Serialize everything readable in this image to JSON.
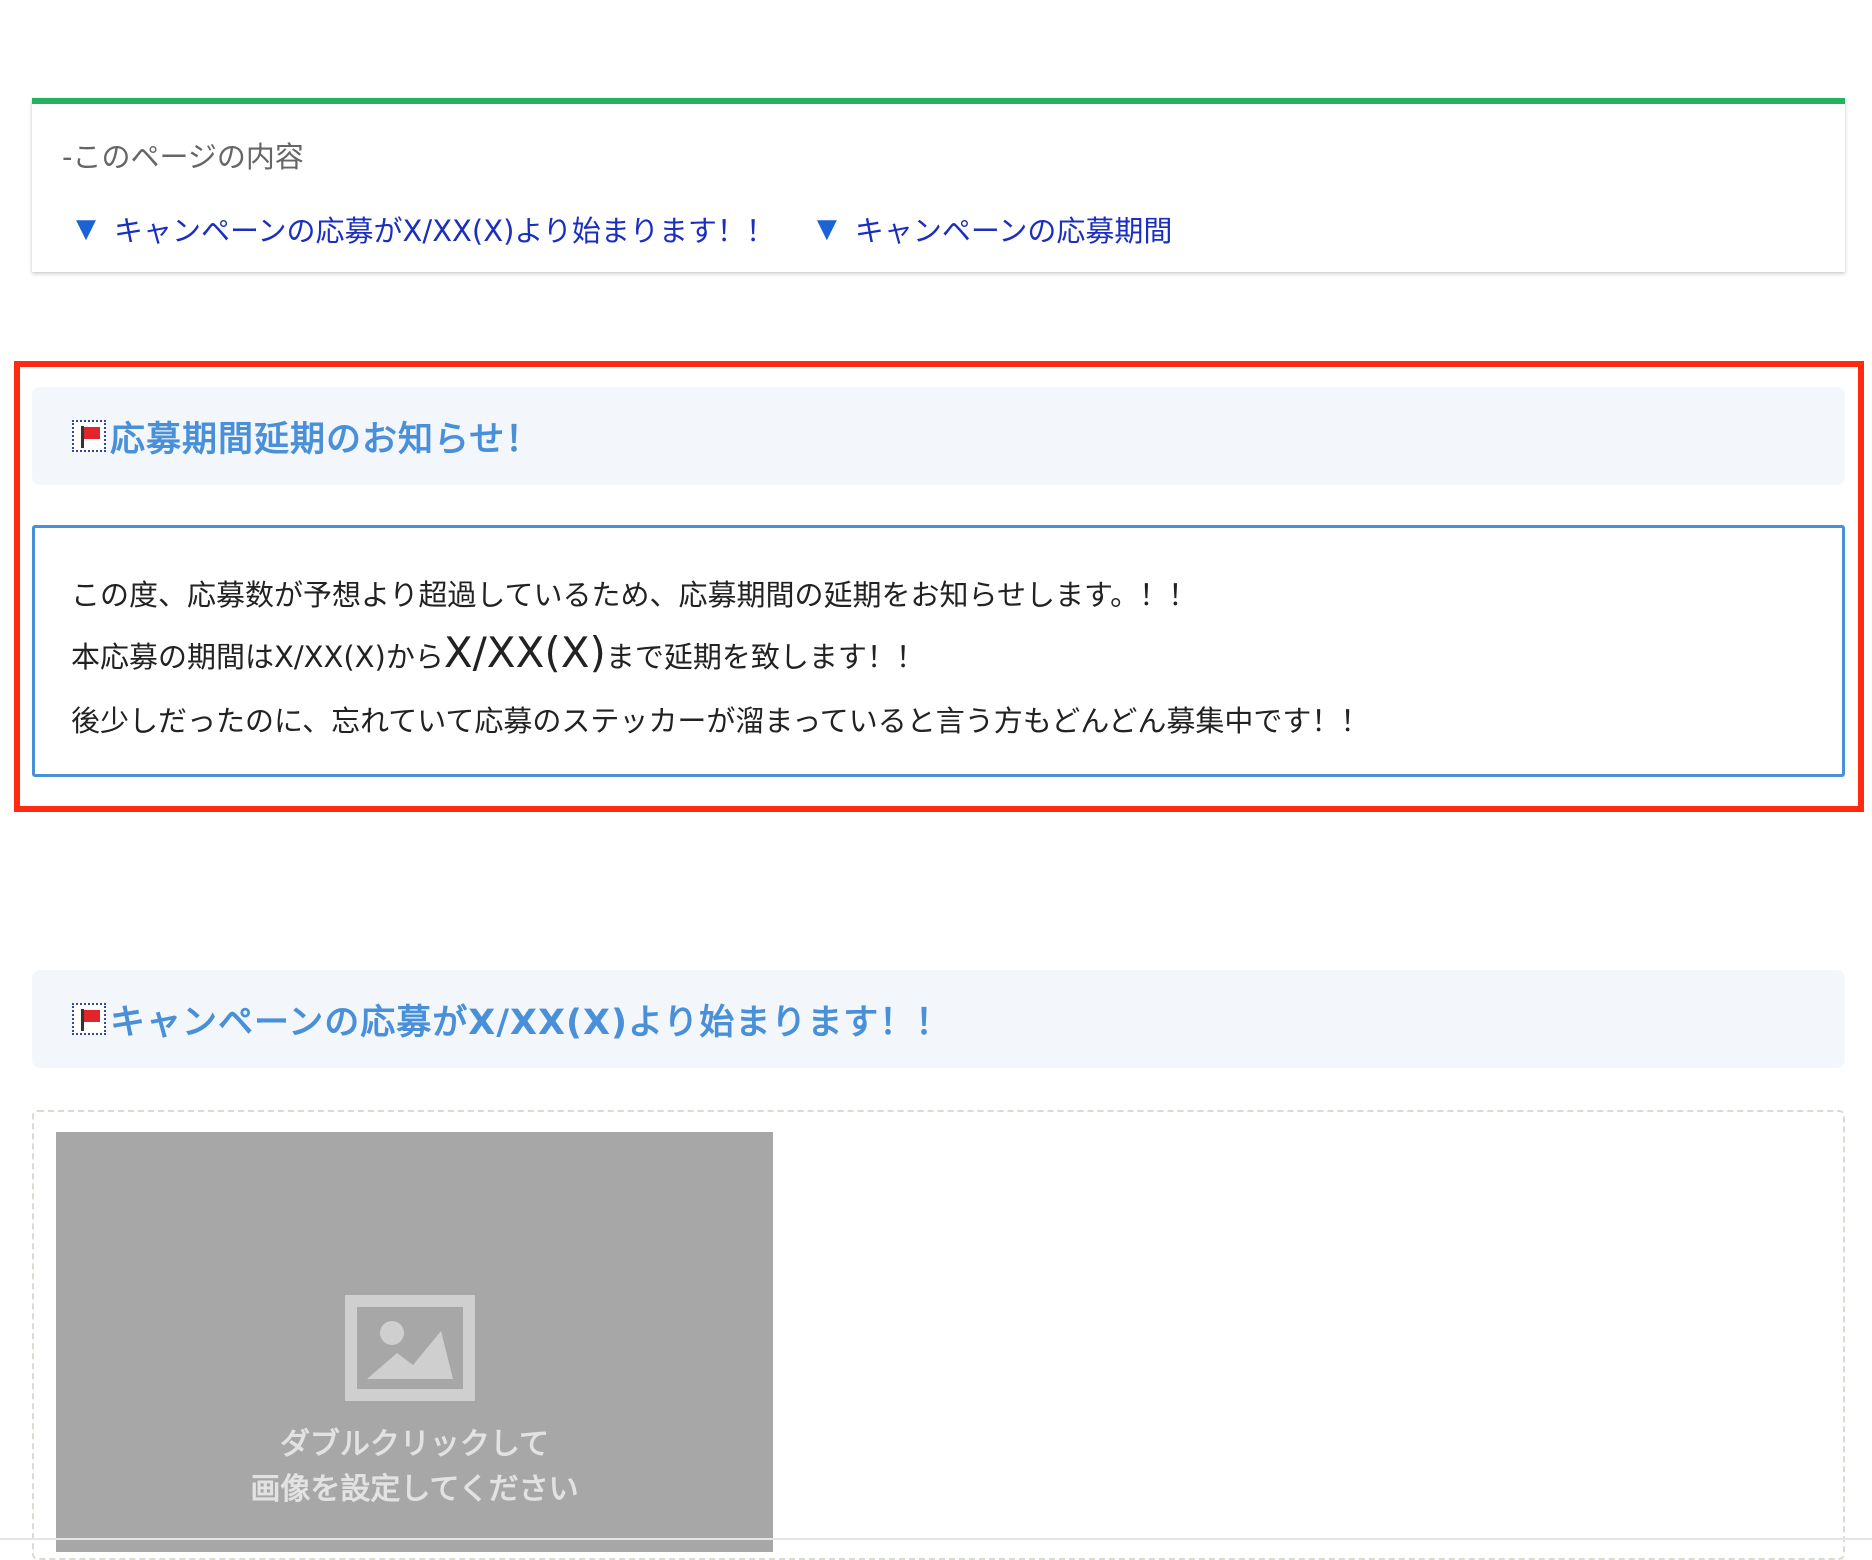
{
  "toc": {
    "title": "-このページの内容",
    "links": [
      {
        "arrow": "▼",
        "label": "キャンペーンの応募がX/XX(X)より始まります！！"
      },
      {
        "arrow": "▼",
        "label": "キャンペーンの応募期間"
      }
    ]
  },
  "notice": {
    "heading": "応募期間延期のお知らせ！",
    "line1": "この度、応募数が予想より超過しているため、応募期間の延期をお知らせします。！！",
    "line2_prefix": "本応募の期間はX/XX(X)から",
    "line2_emphasis": "X/XX(X)",
    "line2_suffix": "まで延期を致します！！",
    "line3": "後少しだったのに、忘れていて応募のステッカーが溜まっていると言う方もどんどん募集中です！！"
  },
  "campaign": {
    "heading": "キャンペーンの応募がX/XX(X)より始まります！！",
    "placeholder_line1": "ダブルクリックして",
    "placeholder_line2": "画像を設定してください"
  },
  "colors": {
    "toc_top_border": "#22b35c",
    "link": "#1a2fbf",
    "heading": "#4a90d9",
    "highlight_frame": "#ff2a10",
    "placeholder_bg": "#a7a7a7"
  },
  "icons": [
    "flag-icon",
    "image-icon"
  ]
}
